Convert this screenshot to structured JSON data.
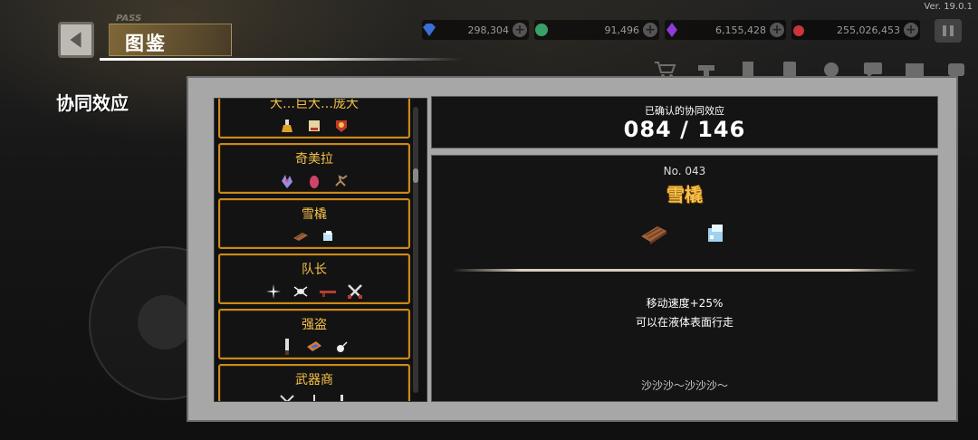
{
  "app": {
    "version": "Ver. 19.0.1",
    "title": "图鉴",
    "pass_label": "PASS"
  },
  "currencies": [
    {
      "name": "gem-blue",
      "value": "298,304",
      "color": "#3b6fd8"
    },
    {
      "name": "coin-green",
      "value": "91,496",
      "color": "#3aa06a"
    },
    {
      "name": "crystal-purple",
      "value": "6,155,428",
      "color": "#8c3bd8"
    },
    {
      "name": "ember-red",
      "value": "255,026,453",
      "color": "#c8353a"
    }
  ],
  "sidebar": {
    "label": "协同效应"
  },
  "synergy_list": [
    {
      "name": "大…巨大…庞大",
      "icons": [
        "potion-icon",
        "scroll-icon",
        "badge-icon"
      ]
    },
    {
      "name": "奇美拉",
      "icons": [
        "crystal-icon",
        "egg-icon",
        "lizard-icon"
      ]
    },
    {
      "name": "雪橇",
      "icons": [
        "plank-icon",
        "ice-icon"
      ]
    },
    {
      "name": "队长",
      "icons": [
        "shuriken-icon",
        "bug-icon",
        "rifle-icon",
        "crossed-swords-icon"
      ]
    },
    {
      "name": "强盗",
      "icons": [
        "knife-icon",
        "bandana-icon",
        "bomb-icon"
      ]
    },
    {
      "name": "武器商",
      "icons": [
        "sword-icon",
        "dagger-icon",
        "blade-icon"
      ]
    }
  ],
  "summary": {
    "label": "已确认的协同效应",
    "value": "084 / 146"
  },
  "detail": {
    "number": "No. 043",
    "name": "雪橇",
    "icons": [
      "plank-icon",
      "ice-icon"
    ],
    "effects": [
      "移动速度+25%",
      "可以在液体表面行走"
    ],
    "flavor": "沙沙沙～沙沙沙～"
  },
  "colors": {
    "accent": "#f7c14a",
    "border": "#c98a1d",
    "panel": "#a7a7a7"
  }
}
